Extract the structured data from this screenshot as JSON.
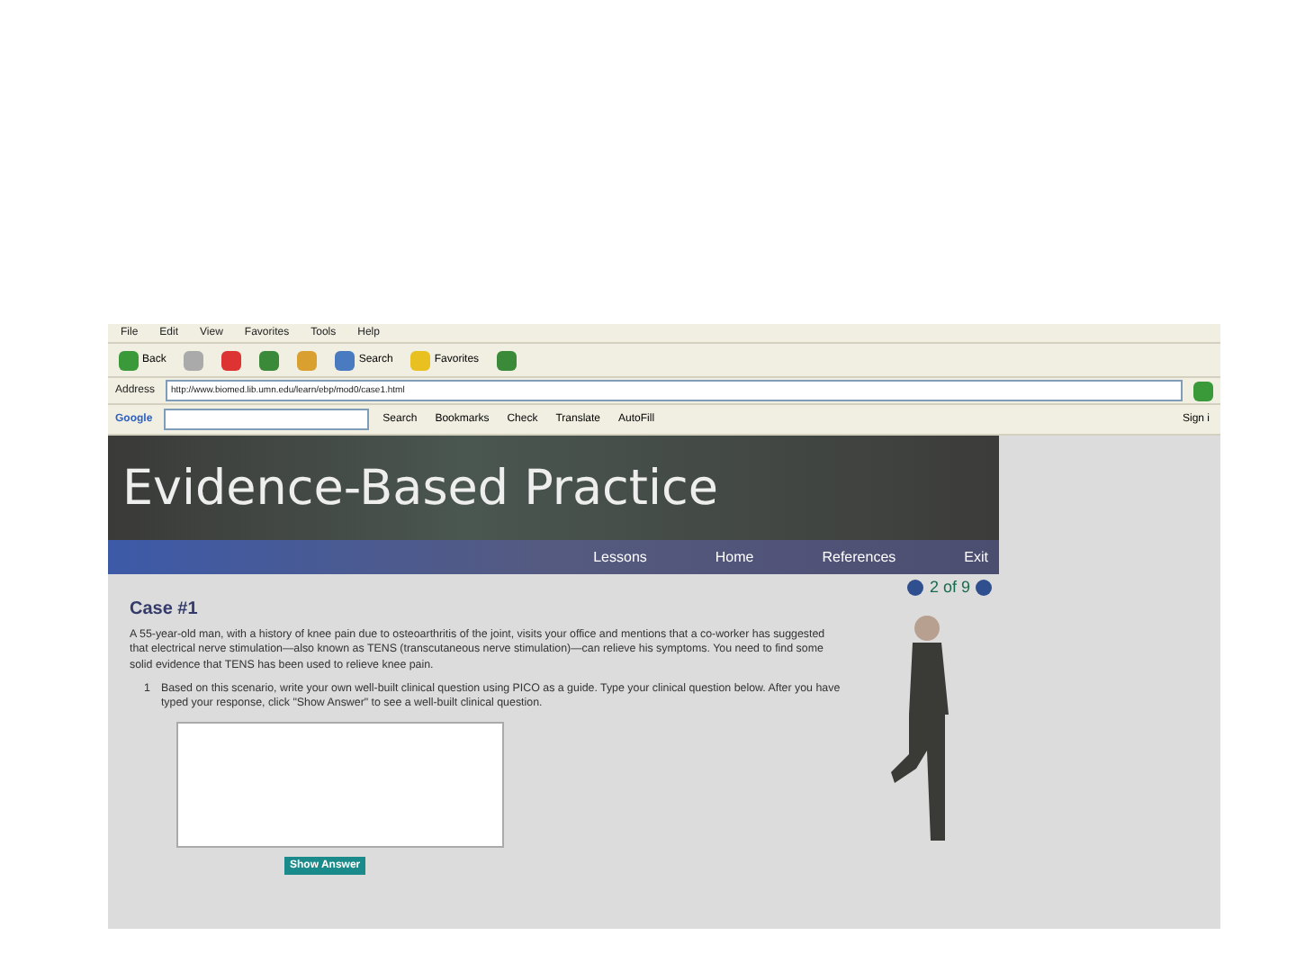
{
  "browser": {
    "menu": [
      "File",
      "Edit",
      "View",
      "Favorites",
      "Tools",
      "Help"
    ],
    "toolbar": [
      {
        "kind": "back",
        "label": "Back"
      },
      {
        "kind": "forward"
      },
      {
        "kind": "stop"
      },
      {
        "kind": "refresh"
      },
      {
        "kind": "home"
      },
      {
        "kind": "search",
        "label": "Search"
      },
      {
        "kind": "favorites",
        "label": "Favorites"
      },
      {
        "kind": "history"
      }
    ],
    "address_label": "Address",
    "url": "http://www.biomed.lib.umn.edu/learn/ebp/mod0/case1.html",
    "google": {
      "logo": "Google",
      "items": [
        "Search",
        "Bookmarks",
        "Check",
        "Translate",
        "AutoFill"
      ],
      "sign_in": "Sign i"
    }
  },
  "page": {
    "title": "Evidence-Based Practice",
    "nav": [
      "Lessons",
      "Home",
      "References",
      "Exit"
    ],
    "pager": "2 of 9",
    "case_title": "Case #1",
    "scenario": "A 55-year-old man, with a history of knee pain due to osteoarthritis of the joint, visits your office and mentions that a co-worker has suggested that electrical nerve stimulation—also known as TENS (transcutaneous nerve stimulation)—can relieve his symptoms. You need to find some solid evidence that TENS has been used to relieve knee pain.",
    "questions": [
      {
        "number": "1",
        "text": "Based on this scenario, write your own well-built clinical question using PICO as a guide. Type your clinical question below. After you have typed your response, click \"Show Answer\" to see a well-built clinical question."
      }
    ],
    "button": "Show Answer"
  }
}
